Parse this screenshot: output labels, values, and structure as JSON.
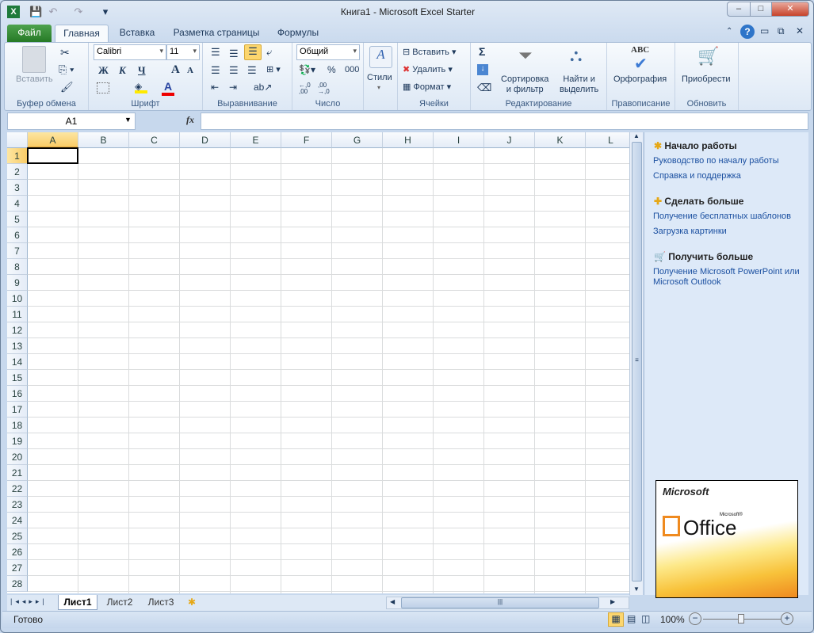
{
  "window": {
    "title": "Книга1  -  Microsoft Excel Starter",
    "minimize": "–",
    "maximize": "□",
    "close": "✕"
  },
  "quick_access": {
    "undo": "↶",
    "redo": "↷",
    "customize": "▾"
  },
  "tabs": [
    {
      "label": "Файл"
    },
    {
      "label": "Главная"
    },
    {
      "label": "Вставка"
    },
    {
      "label": "Разметка страницы"
    },
    {
      "label": "Формулы"
    }
  ],
  "ribbon": {
    "clipboard": {
      "label": "Буфер обмена",
      "paste": "Вставить"
    },
    "font": {
      "label": "Шрифт",
      "name": "Calibri",
      "size": "11",
      "bold": "Ж",
      "italic": "К",
      "underline": "Ч",
      "grow": "A",
      "shrink": "A"
    },
    "alignment": {
      "label": "Выравнивание"
    },
    "number": {
      "label": "Число",
      "format": "Общий",
      "percent": "%",
      "thousands": "000",
      "inc": "←,0 ,00",
      "dec": ",00 →,0"
    },
    "styles": {
      "label": "Стили"
    },
    "cells": {
      "label": "Ячейки",
      "insert": "Вставить",
      "delete": "Удалить",
      "format": "Формат"
    },
    "editing": {
      "label": "Редактирование",
      "sum": "Σ",
      "sort1": "Сортировка",
      "sort2": "и фильтр",
      "find1": "Найти и",
      "find2": "выделить"
    },
    "proofing": {
      "label": "Правописание",
      "spelling": "Орфография",
      "abc": "ABC"
    },
    "update": {
      "label": "Обновить",
      "buy": "Приобрести"
    }
  },
  "formula_bar": {
    "name_box": "A1",
    "fx": "fx",
    "value": ""
  },
  "grid": {
    "columns": [
      "A",
      "B",
      "C",
      "D",
      "E",
      "F",
      "G",
      "H",
      "I",
      "J",
      "K",
      "L"
    ],
    "rows": [
      "1",
      "2",
      "3",
      "4",
      "5",
      "6",
      "7",
      "8",
      "9",
      "10",
      "11",
      "12",
      "13",
      "14",
      "15",
      "16",
      "17",
      "18",
      "19",
      "20",
      "21",
      "22",
      "23",
      "24",
      "25",
      "26",
      "27",
      "28"
    ],
    "selected": "A1"
  },
  "pane": {
    "s1": {
      "title": "Начало работы",
      "links": [
        "Руководство по началу работы",
        "Справка и поддержка"
      ]
    },
    "s2": {
      "title": "Сделать больше",
      "links": [
        "Получение бесплатных шаблонов",
        "Загрузка картинки"
      ]
    },
    "s3": {
      "title": "Получить больше",
      "links": [
        "Получение Microsoft PowerPoint или",
        "Microsoft Outlook"
      ]
    },
    "ad": {
      "brand": "Microsoft",
      "product": "Office",
      "small": "Microsoft®"
    }
  },
  "sheets": [
    {
      "label": "Лист1"
    },
    {
      "label": "Лист2"
    },
    {
      "label": "Лист3"
    }
  ],
  "status": {
    "ready": "Готово",
    "zoom": "100%"
  }
}
